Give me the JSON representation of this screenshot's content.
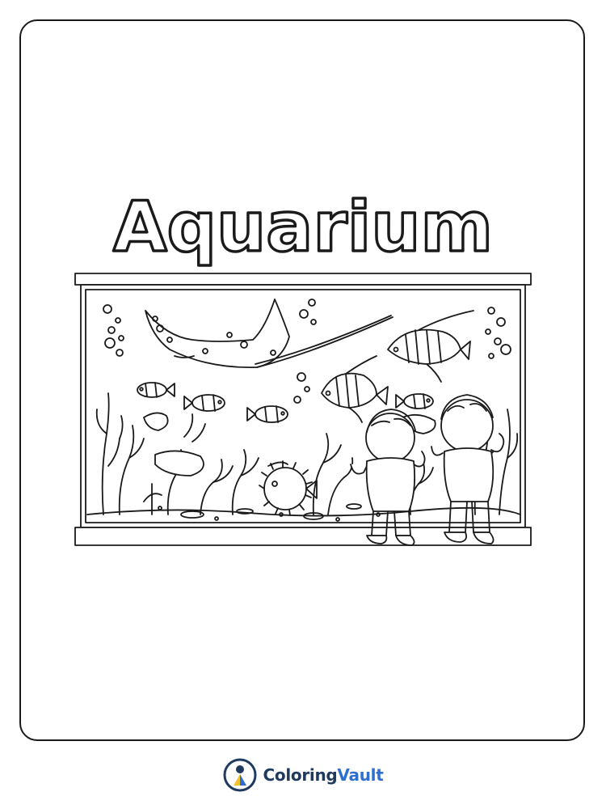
{
  "page": {
    "title": "Aquarium"
  },
  "brand": {
    "name_part1": "Coloring",
    "name_part2": "Vault",
    "logo_icon": "coloringvault-logo-icon"
  },
  "colors": {
    "line": "#1a1a1a",
    "brand_dark": "#1f3a5f",
    "brand_blue": "#2e6fd0",
    "brand_yellow": "#f2c230"
  },
  "illustration": {
    "subject": "aquarium-coloring-illustration"
  }
}
